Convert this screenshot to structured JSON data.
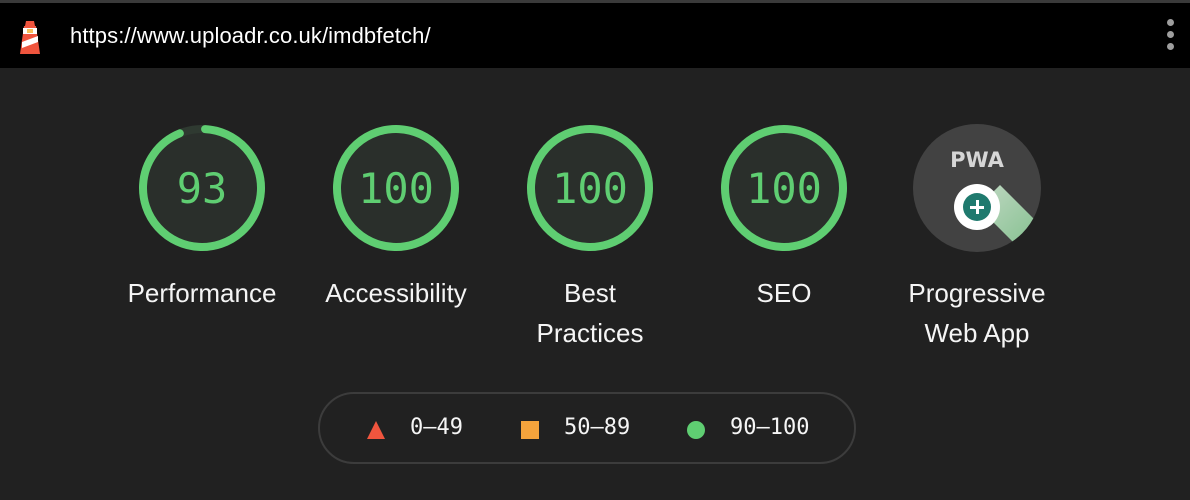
{
  "browser": {
    "url": "https://www.uploadr.co.uk/imdbfetch/"
  },
  "colors": {
    "pass": "#5fce72",
    "average": "#f4a33c",
    "fail": "#f0553e",
    "background": "#212121"
  },
  "categories": [
    {
      "id": "performance",
      "score": 93,
      "display": "93",
      "label_lines": [
        "Performance"
      ]
    },
    {
      "id": "accessibility",
      "score": 100,
      "display": "100",
      "label_lines": [
        "Accessibility"
      ]
    },
    {
      "id": "best-practices",
      "score": 100,
      "display": "100",
      "label_lines": [
        "Best",
        "Practices"
      ]
    },
    {
      "id": "seo",
      "score": 100,
      "display": "100",
      "label_lines": [
        "SEO"
      ]
    }
  ],
  "pwa": {
    "badge_text": "PWA",
    "label_lines": [
      "Progressive",
      "Web App"
    ],
    "icon": "pwa-plus-badge-icon"
  },
  "legend": [
    {
      "shape": "triangle",
      "range": "0–49"
    },
    {
      "shape": "square",
      "range": "50–89"
    },
    {
      "shape": "circle",
      "range": "90–100"
    }
  ]
}
